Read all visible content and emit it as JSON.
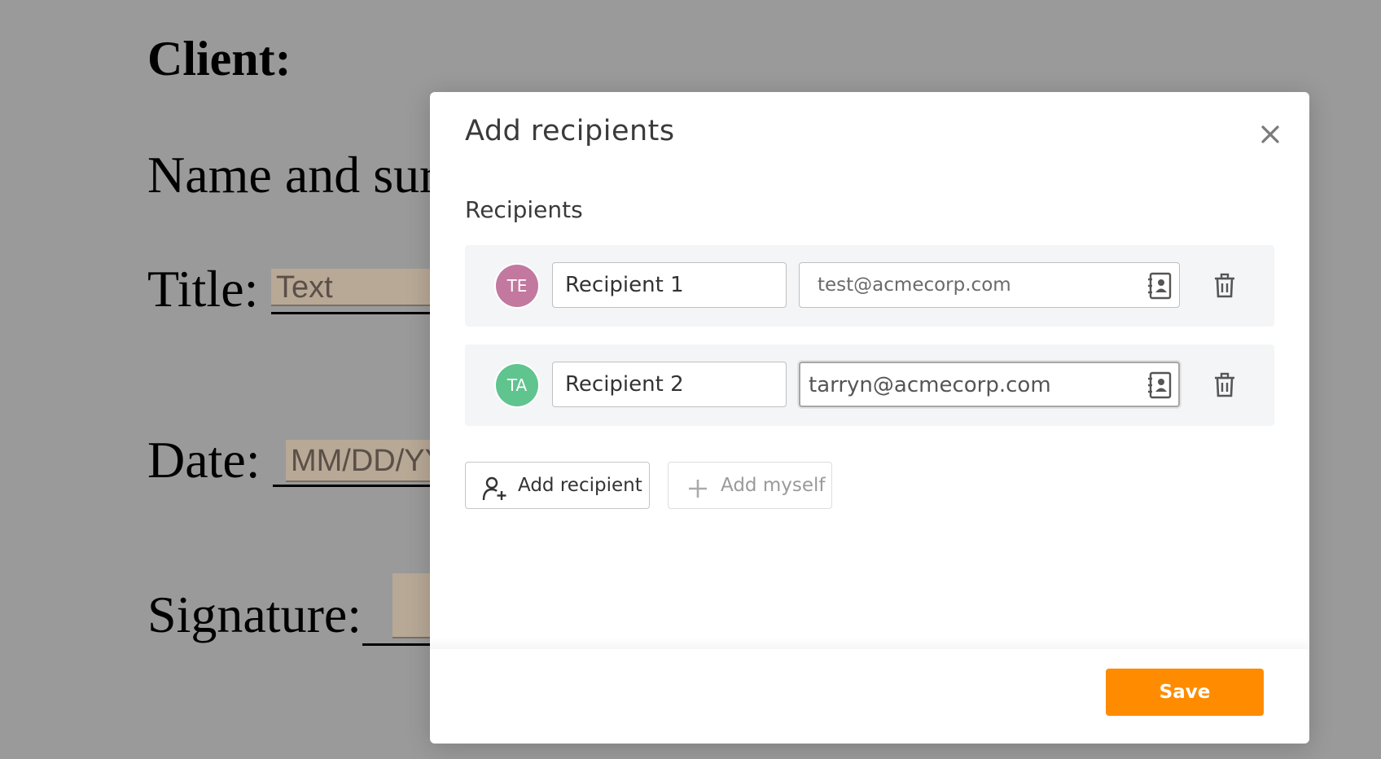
{
  "document": {
    "client_heading": "Client:",
    "name_label": "Name and sur",
    "title_label": "Title:",
    "title_field_placeholder": "Text",
    "date_label": "Date:",
    "date_field_placeholder": "MM/DD/YY",
    "signature_label": "Signature:"
  },
  "modal": {
    "title": "Add recipients",
    "close_icon": "close-icon",
    "section_label": "Recipients",
    "recipients": [
      {
        "initials": "TE",
        "avatar_color": "#c2789f",
        "name": "Recipient 1",
        "email": "test@acmecorp.com",
        "email_focused": false
      },
      {
        "initials": "TA",
        "avatar_color": "#5fc48d",
        "name": "Recipient 2",
        "email": "tarryn@acmecorp.com",
        "email_focused": true
      }
    ],
    "add_recipient_label": "Add recipient",
    "add_myself_label": "Add myself",
    "save_label": "Save"
  },
  "colors": {
    "accent": "#ff8c00",
    "overlay": "#9a9a9a"
  }
}
